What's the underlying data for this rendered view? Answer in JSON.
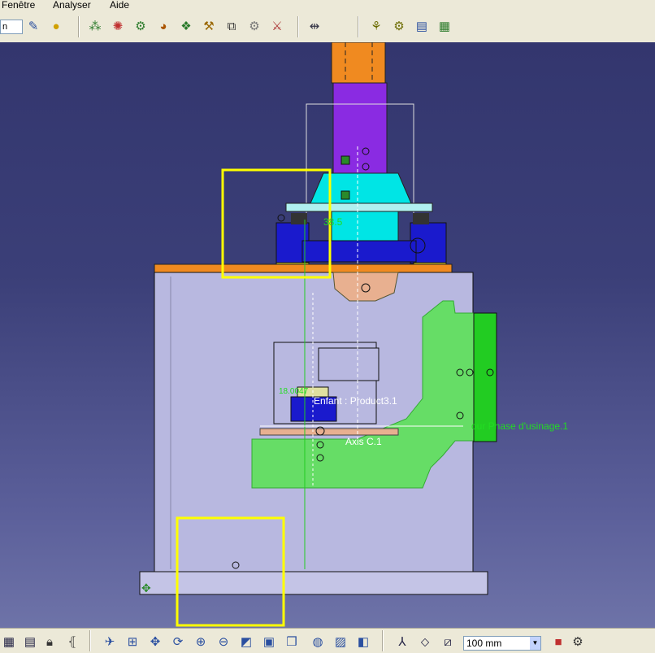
{
  "menu": {
    "fenetre": "Fenêtre",
    "analyser": "Analyser",
    "aide": "Aide"
  },
  "toolbar": {
    "left_combo_value": "n"
  },
  "viewport": {
    "label_dim": "38.5",
    "label_child_product": "Enfant : Product3.1",
    "label_phase": "our Phase d'usinage.1",
    "label_axis": "Axis C.1",
    "label_dim2": "18.0047"
  },
  "statusbar": {
    "zoom_value": "100 mm"
  },
  "colors": {
    "background_top": "#33366e",
    "background_bottom": "#6e73a8",
    "highlight_box": "#ffff00",
    "purple_part": "#8a2be2",
    "cyan_part": "#00ffff",
    "blue_part": "#1a1acd",
    "green_part": "#66dd66"
  }
}
